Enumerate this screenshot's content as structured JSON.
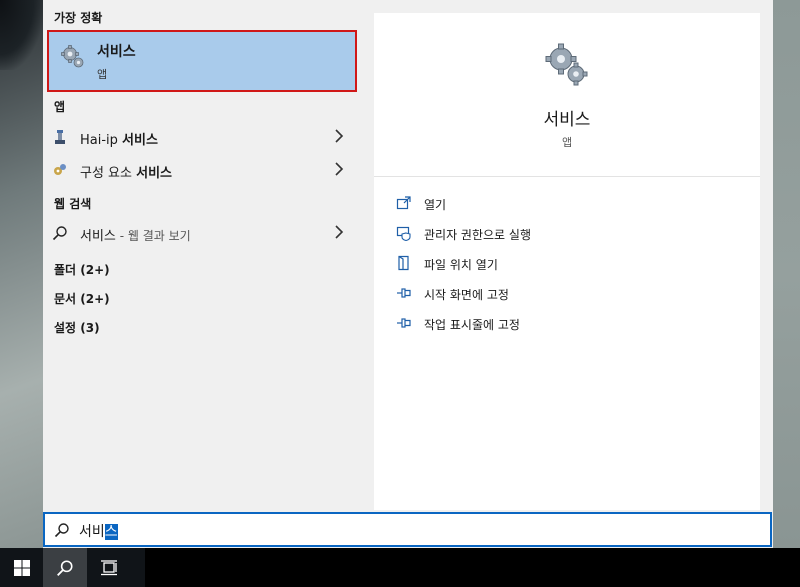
{
  "left_pane": {
    "best_match_header": "가장 정확",
    "best_match": {
      "title": "서비스",
      "subtitle": "앱",
      "icon": "gears-icon"
    },
    "apps_header": "앱",
    "apps": [
      {
        "prefix": "Hai-ip ",
        "bold": "서비스",
        "icon": "hai-ip-app-icon"
      },
      {
        "prefix": "구성 요소 ",
        "bold": "서비스",
        "icon": "component-services-icon"
      }
    ],
    "web_header": "웹 검색",
    "web": {
      "query": "서비스",
      "suffix": " - 웹 결과 보기",
      "icon": "search-icon"
    },
    "categories": [
      "폴더 (2+)",
      "문서 (2+)",
      "설정 (3)"
    ]
  },
  "right_pane": {
    "title": "서비스",
    "subtitle": "앱",
    "icon": "gears-icon",
    "actions": [
      {
        "label": "열기",
        "icon": "open-icon"
      },
      {
        "label": "관리자 권한으로 실행",
        "icon": "run-as-admin-icon"
      },
      {
        "label": "파일 위치 열기",
        "icon": "file-location-icon"
      },
      {
        "label": "시작 화면에 고정",
        "icon": "pin-icon"
      },
      {
        "label": "작업 표시줄에 고정",
        "icon": "pin-icon"
      }
    ]
  },
  "search": {
    "typed": "서비",
    "selected": "스"
  },
  "colors": {
    "accent": "#0a66c2",
    "highlight": "#a9cbeb",
    "selection_border": "#d01818",
    "taskbar": "#101418"
  }
}
